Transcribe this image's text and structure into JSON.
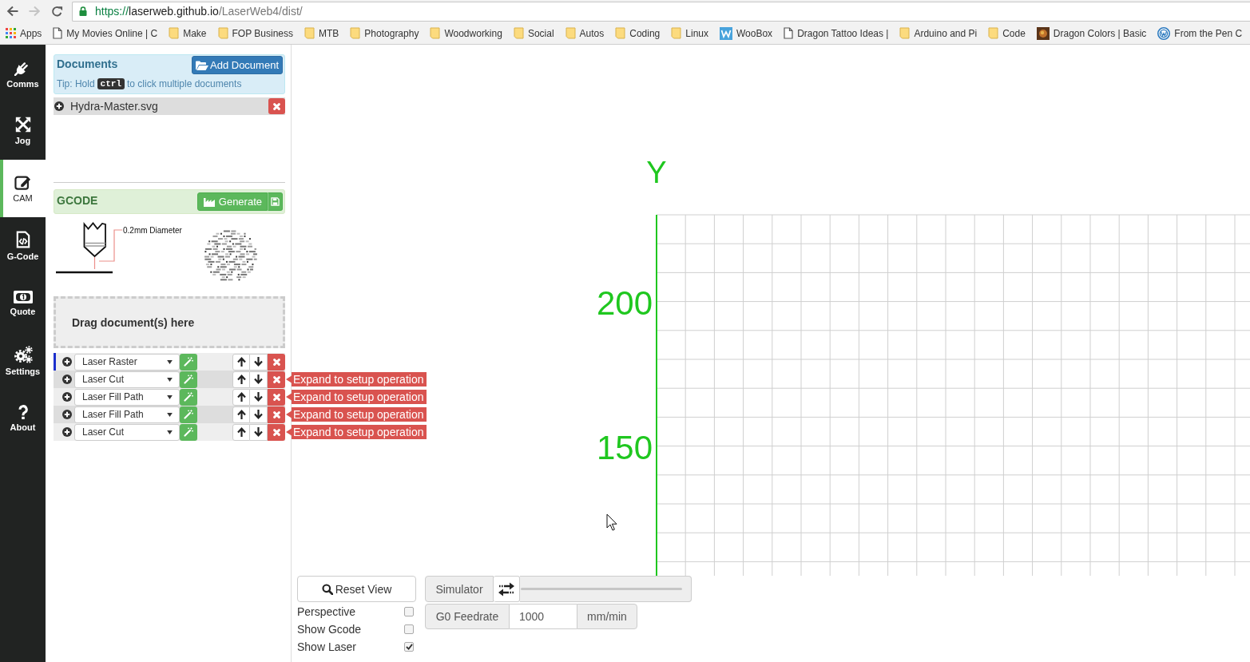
{
  "browser": {
    "nav_buttons": [
      {
        "kind": "back",
        "disabled": false
      },
      {
        "kind": "forward",
        "disabled": true
      },
      {
        "kind": "reload",
        "disabled": false
      }
    ],
    "address_bar": {
      "scheme": "https://",
      "host": "laserweb.github.io",
      "path": "/LaserWeb4/dist/"
    },
    "bookmarks": [
      {
        "kind": "apps",
        "label": "Apps"
      },
      {
        "kind": "page",
        "label": "My Movies Online | C"
      },
      {
        "kind": "folder",
        "label": "Make"
      },
      {
        "kind": "folder",
        "label": "FOP Business"
      },
      {
        "kind": "folder",
        "label": "MTB"
      },
      {
        "kind": "folder",
        "label": "Photography"
      },
      {
        "kind": "folder",
        "label": "Woodworking"
      },
      {
        "kind": "folder",
        "label": "Social"
      },
      {
        "kind": "folder",
        "label": "Autos"
      },
      {
        "kind": "folder",
        "label": "Coding"
      },
      {
        "kind": "folder",
        "label": "Linux"
      },
      {
        "kind": "tile",
        "label": "WooBox"
      },
      {
        "kind": "page",
        "label": "Dragon Tattoo Ideas |"
      },
      {
        "kind": "folder",
        "label": "Arduino and Pi"
      },
      {
        "kind": "folder",
        "label": "Code"
      },
      {
        "kind": "photo",
        "label": "Dragon Colors | Basic"
      },
      {
        "kind": "globe",
        "label": "From the Pen C"
      }
    ]
  },
  "sidebar": {
    "items": [
      {
        "label": "Comms",
        "selected": false
      },
      {
        "label": "Jog",
        "selected": false
      },
      {
        "label": "CAM",
        "selected": true
      },
      {
        "label": "G-Code",
        "selected": false
      },
      {
        "label": "Quote",
        "selected": false
      },
      {
        "label": "Settings",
        "selected": false
      },
      {
        "label": "About",
        "selected": false
      }
    ]
  },
  "documents": {
    "title": "Documents",
    "add_button": "Add Document",
    "tip": {
      "before": "Tip: Hold",
      "key": "ctrl",
      "after": "to click multiple documents"
    },
    "files": [
      {
        "name": "Hydra-Master.svg"
      }
    ]
  },
  "gcode": {
    "title": "GCODE",
    "generate_button": "Generate",
    "diameter_label": "0.2mm Diameter"
  },
  "drop_zone": {
    "text": "Drag document(s) here"
  },
  "operations": [
    {
      "type": "Laser Raster",
      "selected": true
    },
    {
      "type": "Laser Cut",
      "selected": false,
      "tooltip": "Expand to setup operation"
    },
    {
      "type": "Laser Fill Path",
      "selected": false,
      "tooltip": "Expand to setup operation"
    },
    {
      "type": "Laser Fill Path",
      "selected": false,
      "tooltip": "Expand to setup operation"
    },
    {
      "type": "Laser Cut",
      "selected": false,
      "tooltip": "Expand to setup operation"
    }
  ],
  "viewport": {
    "axis_label": "Y",
    "tick_labels": [
      "200",
      "150"
    ]
  },
  "view_controls": {
    "reset_button": "Reset View",
    "options": [
      {
        "label": "Perspective",
        "checked": false
      },
      {
        "label": "Show Gcode",
        "checked": false
      },
      {
        "label": "Show Laser",
        "checked": true
      }
    ],
    "simulator": {
      "label": "Simulator",
      "level": 1
    },
    "feedrate": {
      "label": "G0 Feedrate",
      "value": "1000",
      "unit": "mm/min"
    }
  }
}
